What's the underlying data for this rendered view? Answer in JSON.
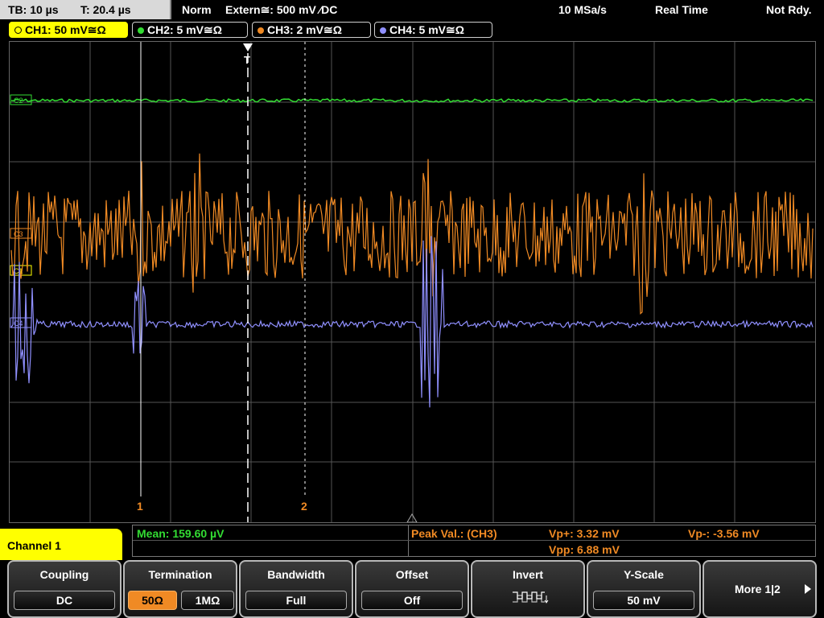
{
  "status_bar": {
    "timebase": "TB: 10 µs",
    "trigger_time": "T: 20.4 µs",
    "mode": "Norm",
    "trigger_source": "Extern≅: 500 mV ⁄DC",
    "sample_rate": "10 MSa/s",
    "acq_mode": "Real Time",
    "trigger_state": "Not Rdy."
  },
  "channels": [
    {
      "label": "CH1: 50 mV≅Ω",
      "color": "#ffff00",
      "selected": true
    },
    {
      "label": "CH2: 5 mV≅Ω",
      "color": "#33dd33",
      "selected": false
    },
    {
      "label": "CH3: 2 mV≅Ω",
      "color": "#f08a24",
      "selected": false
    },
    {
      "label": "CH4: 5 mV≅Ω",
      "color": "#9090ff",
      "selected": false
    }
  ],
  "cursors": {
    "c1": "1",
    "c2": "2",
    "trigger_marker": "T"
  },
  "channel_markers": {
    "ch1": "C1",
    "ch2": "C2",
    "ch3": "C3",
    "ch4": "C4"
  },
  "measurements": {
    "mean": "Mean: 159.60 µV",
    "peak_label": "Peak Val.:  (CH3)",
    "vp_plus": "Vp+: 3.32 mV",
    "vp_minus": "Vp-: -3.56 mV",
    "vpp": "Vpp: 6.88 mV"
  },
  "menu": {
    "channel_title": "Channel 1",
    "coupling": {
      "title": "Coupling",
      "value": "DC"
    },
    "termination": {
      "title": "Termination",
      "opt1": "50Ω",
      "opt2": "1MΩ",
      "selected": "50Ω"
    },
    "bandwidth": {
      "title": "Bandwidth",
      "value": "Full"
    },
    "offset": {
      "title": "Offset",
      "value": "Off"
    },
    "invert": {
      "title": "Invert"
    },
    "yscale": {
      "title": "Y-Scale",
      "value": "50 mV"
    },
    "more": {
      "title": "More 1|2"
    }
  },
  "colors": {
    "ch1": "#ffff00",
    "ch2": "#33dd33",
    "ch3": "#f08a24",
    "ch4": "#9090ff",
    "grid": "#555555"
  }
}
